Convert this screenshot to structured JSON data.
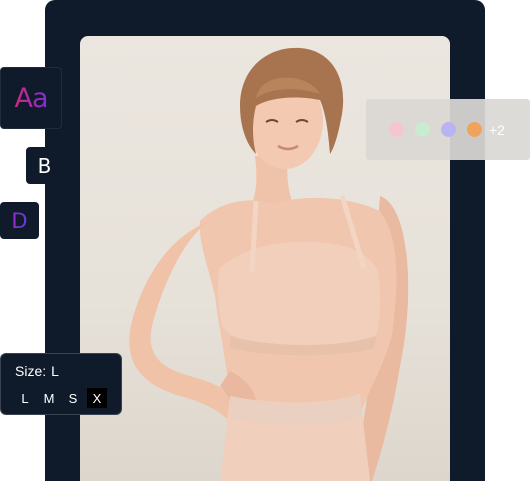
{
  "font_card": {
    "sample": "Aa"
  },
  "style_b": {
    "letter": "B"
  },
  "style_d": {
    "letter": "D"
  },
  "size_selector": {
    "label": "Size:",
    "selected": "L",
    "options": [
      "L",
      "M",
      "S",
      "X"
    ],
    "highlighted": "X"
  },
  "color_selector": {
    "swatches": [
      {
        "name": "pink",
        "color": "#f5c6cf"
      },
      {
        "name": "mint",
        "color": "#c7ecd0"
      },
      {
        "name": "lavender",
        "color": "#b9b3f2"
      },
      {
        "name": "orange",
        "color": "#f0a35a"
      }
    ],
    "more_label": "+2"
  },
  "colors": {
    "frame": "#0f1a2b",
    "accent_gradient_start": "#d0287a",
    "accent_gradient_end": "#7a2fd8"
  }
}
